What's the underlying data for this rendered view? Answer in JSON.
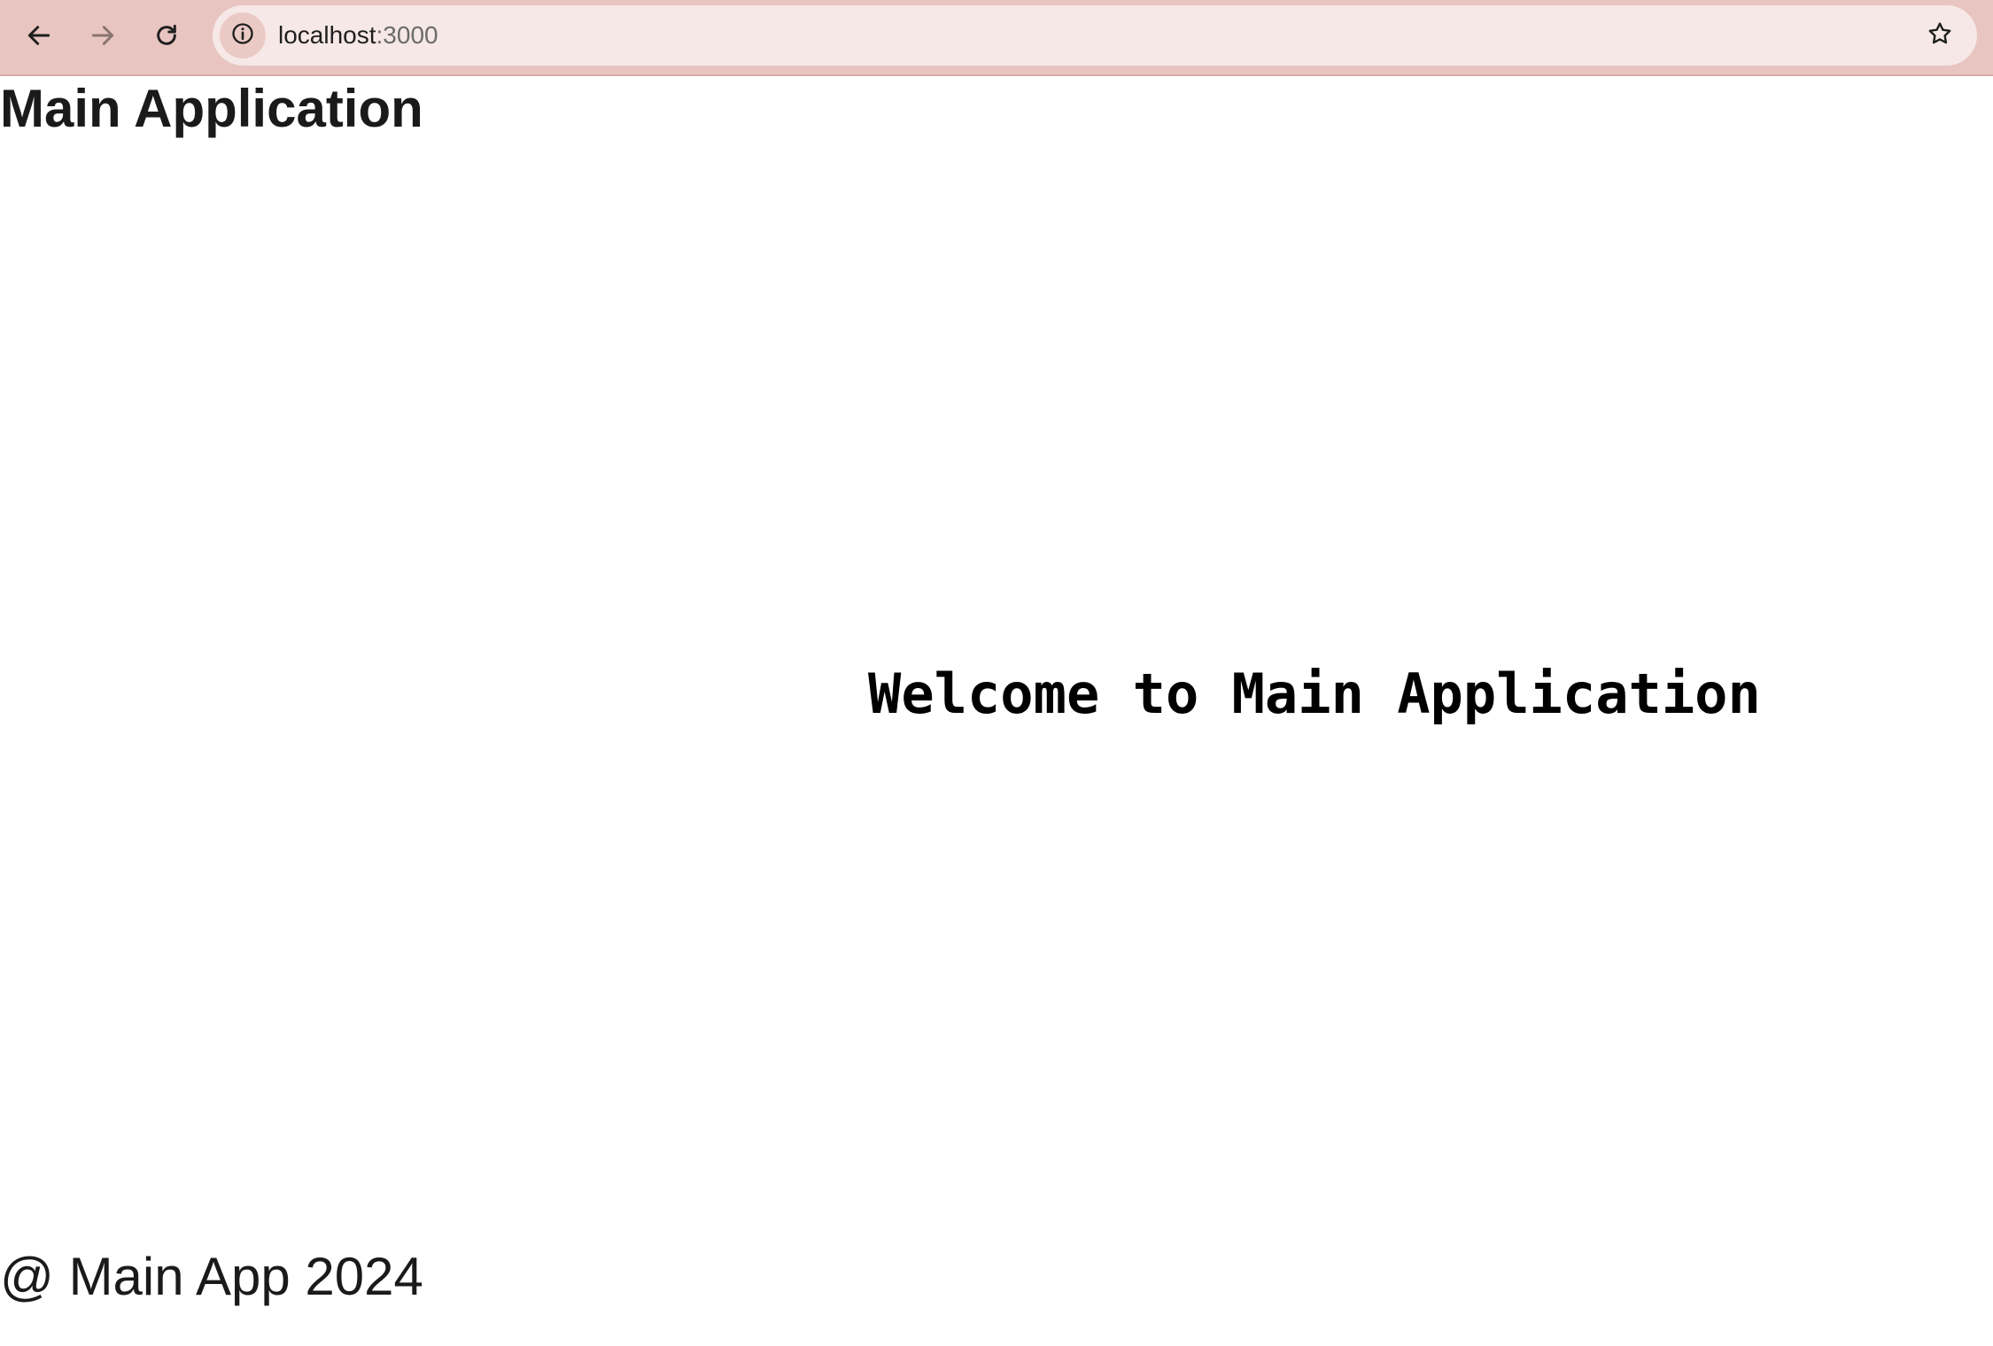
{
  "browser": {
    "url_host": "localhost",
    "url_port": ":3000",
    "icons": {
      "back": "back-arrow-icon",
      "forward": "forward-arrow-icon",
      "reload": "reload-icon",
      "site_info": "info-icon",
      "bookmark": "star-icon"
    },
    "colors": {
      "toolbar": "#e8c5c0",
      "omnibox": "#f6e8e6"
    }
  },
  "page": {
    "header_title": "Main Application",
    "welcome_text": "Welcome to Main Application",
    "footer_text": "@ Main App 2024"
  }
}
